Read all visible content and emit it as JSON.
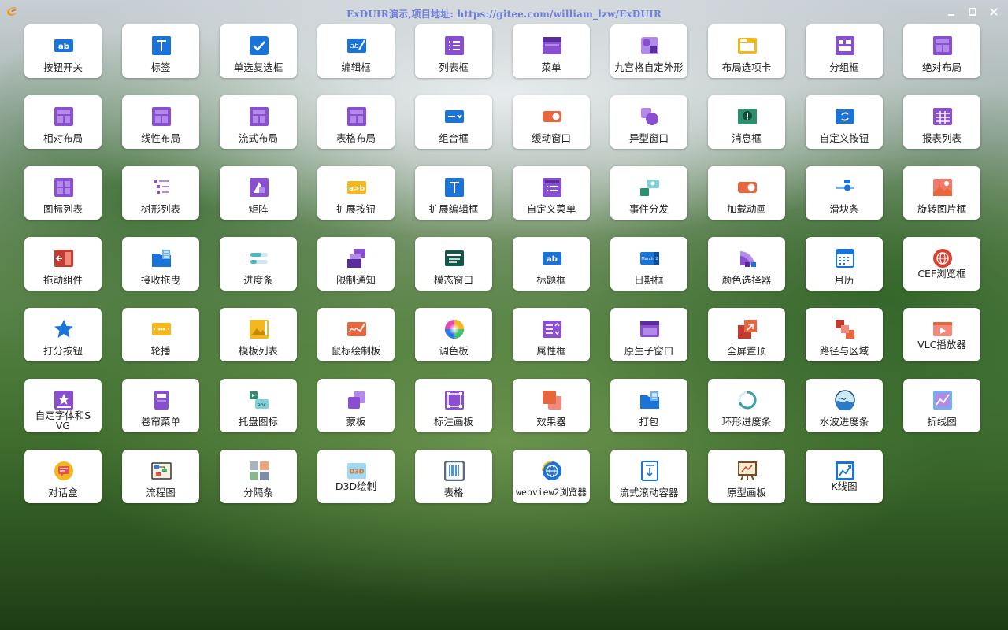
{
  "window": {
    "title": "ExDUIR演示,项目地址: https://gitee.com/william_lzw/ExDUIR",
    "controls": [
      {
        "name": "minimize-button",
        "icon": "minimize-icon"
      },
      {
        "name": "maximize-button",
        "icon": "maximize-icon"
      },
      {
        "name": "close-button",
        "icon": "close-icon"
      }
    ]
  },
  "colors": {
    "title": "#6f7fdc",
    "purple": "#8a4fd0",
    "blue": "#1a73d9",
    "orange": "#e8663e",
    "yellow": "#f2b81d"
  },
  "tiles": [
    {
      "label": "按钮开关",
      "icon": "ab-icon"
    },
    {
      "label": "标签",
      "icon": "text-t-icon"
    },
    {
      "label": "单选复选框",
      "icon": "checkbox-icon"
    },
    {
      "label": "编辑框",
      "icon": "edit-ab-icon"
    },
    {
      "label": "列表框",
      "icon": "list-icon"
    },
    {
      "label": "菜单",
      "icon": "menu-icon"
    },
    {
      "label": "九宫格自定外形",
      "icon": "shape-icon"
    },
    {
      "label": "布局选项卡",
      "icon": "tab-icon"
    },
    {
      "label": "分组框",
      "icon": "group-icon"
    },
    {
      "label": "绝对布局",
      "icon": "layout-icon"
    },
    {
      "label": "相对布局",
      "icon": "layout-icon"
    },
    {
      "label": "线性布局",
      "icon": "layout-icon"
    },
    {
      "label": "流式布局",
      "icon": "layout-icon"
    },
    {
      "label": "表格布局",
      "icon": "layout-icon"
    },
    {
      "label": "组合框",
      "icon": "combobox-icon"
    },
    {
      "label": "缓动窗口",
      "icon": "toggle-orange-icon"
    },
    {
      "label": "异型窗口",
      "icon": "shapes-icon"
    },
    {
      "label": "消息框",
      "icon": "alert-icon"
    },
    {
      "label": "自定义按钮",
      "icon": "refresh-button-icon"
    },
    {
      "label": "报表列表",
      "icon": "table-icon"
    },
    {
      "label": "图标列表",
      "icon": "grid-icon"
    },
    {
      "label": "树形列表",
      "icon": "tree-icon"
    },
    {
      "label": "矩阵",
      "icon": "matrix-icon"
    },
    {
      "label": "扩展按钮",
      "icon": "ab-arrow-icon"
    },
    {
      "label": "扩展编辑框",
      "icon": "text-t-icon"
    },
    {
      "label": "自定义菜单",
      "icon": "custom-menu-icon"
    },
    {
      "label": "事件分发",
      "icon": "event-icon"
    },
    {
      "label": "加载动画",
      "icon": "toggle-orange-icon"
    },
    {
      "label": "滑块条",
      "icon": "slider-icon"
    },
    {
      "label": "旋转图片框",
      "icon": "image-icon"
    },
    {
      "label": "拖动组件",
      "icon": "drag-icon"
    },
    {
      "label": "接收拖曳",
      "icon": "folder-doc-icon"
    },
    {
      "label": "进度条",
      "icon": "progress-icon"
    },
    {
      "label": "限制通知",
      "icon": "stack-icon"
    },
    {
      "label": "模态窗口",
      "icon": "modal-icon"
    },
    {
      "label": "标题框",
      "icon": "ab-icon"
    },
    {
      "label": "日期框",
      "icon": "date-icon"
    },
    {
      "label": "颜色选择器",
      "icon": "palette-fan-icon"
    },
    {
      "label": "月历",
      "icon": "calendar-icon"
    },
    {
      "label": "CEF浏览框",
      "icon": "globe-red-icon",
      "wrap": true
    },
    {
      "label": "打分按钮",
      "icon": "star-icon"
    },
    {
      "label": "轮播",
      "icon": "carousel-icon"
    },
    {
      "label": "模板列表",
      "icon": "template-icon"
    },
    {
      "label": "鼠标绘制板",
      "icon": "signature-icon"
    },
    {
      "label": "调色板",
      "icon": "color-wheel-icon"
    },
    {
      "label": "属性框",
      "icon": "property-icon"
    },
    {
      "label": "原生子窗口",
      "icon": "window-icon"
    },
    {
      "label": "全屏置顶",
      "icon": "fullscreen-icon"
    },
    {
      "label": "路径与区域",
      "icon": "path-icon"
    },
    {
      "label": "VLC播放器",
      "icon": "video-icon",
      "wrap": true
    },
    {
      "label": "自定字体和SVG",
      "icon": "font-star-icon",
      "wrap": true
    },
    {
      "label": "卷帘菜单",
      "icon": "rollup-icon"
    },
    {
      "label": "托盘图标",
      "icon": "tray-icon"
    },
    {
      "label": "蒙板",
      "icon": "mask-icon"
    },
    {
      "label": "标注画板",
      "icon": "annotate-icon"
    },
    {
      "label": "效果器",
      "icon": "effect-icon"
    },
    {
      "label": "打包",
      "icon": "folder-doc-icon"
    },
    {
      "label": "环形进度条",
      "icon": "ring-icon"
    },
    {
      "label": "水波进度条",
      "icon": "wave-icon"
    },
    {
      "label": "折线图",
      "icon": "line-chart-icon"
    },
    {
      "label": "对话盒",
      "icon": "chat-icon"
    },
    {
      "label": "流程图",
      "icon": "flowchart-icon"
    },
    {
      "label": "分隔条",
      "icon": "splitter-icon"
    },
    {
      "label": "D3D绘制",
      "icon": "d3d-icon",
      "wrap": true
    },
    {
      "label": "表格",
      "icon": "barcode-icon"
    },
    {
      "label": "webview2浏览器",
      "icon": "globe-blue-icon",
      "mono": true
    },
    {
      "label": "流式滚动容器",
      "icon": "scroll-icon"
    },
    {
      "label": "原型画板",
      "icon": "easel-icon"
    },
    {
      "label": "K线图",
      "icon": "k-chart-icon",
      "wrap": true
    }
  ]
}
